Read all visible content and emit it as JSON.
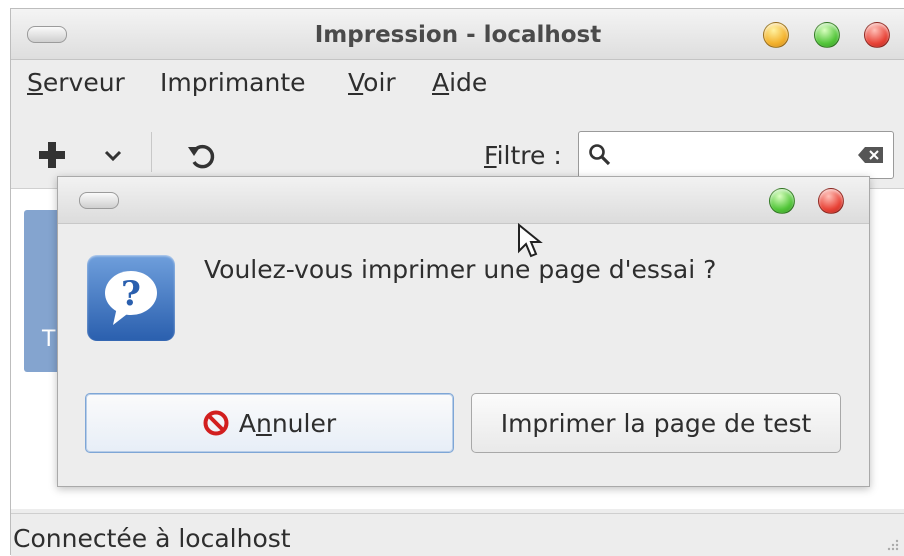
{
  "window": {
    "title": "Impression - localhost"
  },
  "menu": [
    {
      "first": "S",
      "rest": "erveur"
    },
    {
      "first": "",
      "rest": "Imprimante"
    },
    {
      "first": "V",
      "rest": "oir"
    },
    {
      "first": "A",
      "rest": "ide"
    }
  ],
  "toolbar": {
    "filter_label_first": "F",
    "filter_label_rest": "iltre :",
    "search_value": ""
  },
  "content": {
    "printer_tile_letter": "T"
  },
  "statusbar": {
    "text": "Connectée à localhost"
  },
  "dialog": {
    "question": "Voulez-vous imprimer une page d'essai ?",
    "cancel_pre": "A",
    "cancel_mnemonic": "n",
    "cancel_post": "nuler",
    "test_button": "Imprimer la page de test"
  },
  "colors": {
    "accent": "#84a4cf",
    "dialog_icon": "#2a5fae",
    "cancel_icon": "#d21f1f"
  },
  "icons": {
    "add": "plus-icon",
    "dropdown": "chevron-down-icon",
    "refresh": "refresh-icon",
    "search": "search-icon",
    "clear": "clear-text-icon",
    "question": "question-icon",
    "cancel": "cancel-icon"
  }
}
